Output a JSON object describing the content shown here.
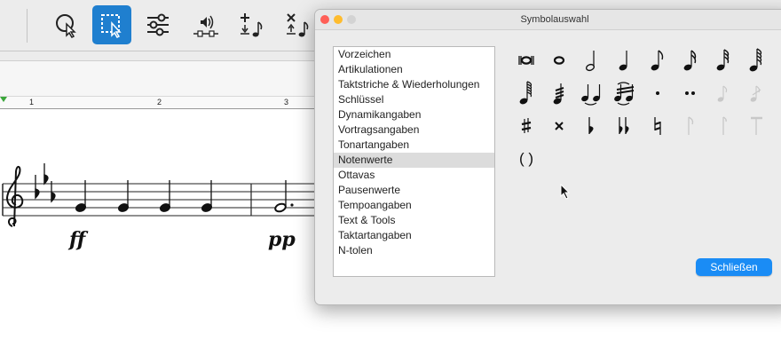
{
  "dialog": {
    "title": "Symbolauswahl",
    "close_label": "Schließen",
    "categories": [
      "Vorzeichen",
      "Artikulationen",
      "Taktstriche & Wiederholungen",
      "Schlüssel",
      "Dynamikangaben",
      "Vortragsangaben",
      "Tonartangaben",
      "Notenwerte",
      "Ottavas",
      "Pausenwerte",
      "Tempoangaben",
      "Text & Tools",
      "Taktartangaben",
      "N-tolen"
    ],
    "selected_category": "Notenwerte",
    "parentheses_symbol": "( )"
  },
  "ruler": {
    "numbers": [
      "1",
      "2",
      "3"
    ]
  },
  "score": {
    "dynamics": [
      "ff",
      "pp"
    ]
  },
  "toolbar": {
    "icons": [
      "lasso-select-icon",
      "rect-select-icon",
      "mixer-sliders-icon",
      "playback-speaker-icon",
      "insert-note-icon",
      "delete-note-icon"
    ],
    "active": "rect-select-icon"
  },
  "colors": {
    "accent": "#1f7fcf",
    "primary_button": "#1a8cf5",
    "selected_row": "#dcdcdc",
    "traffic_close": "#ff5f57",
    "traffic_minimize": "#febc2e",
    "disabled_symbol": "#c8c8c8"
  }
}
